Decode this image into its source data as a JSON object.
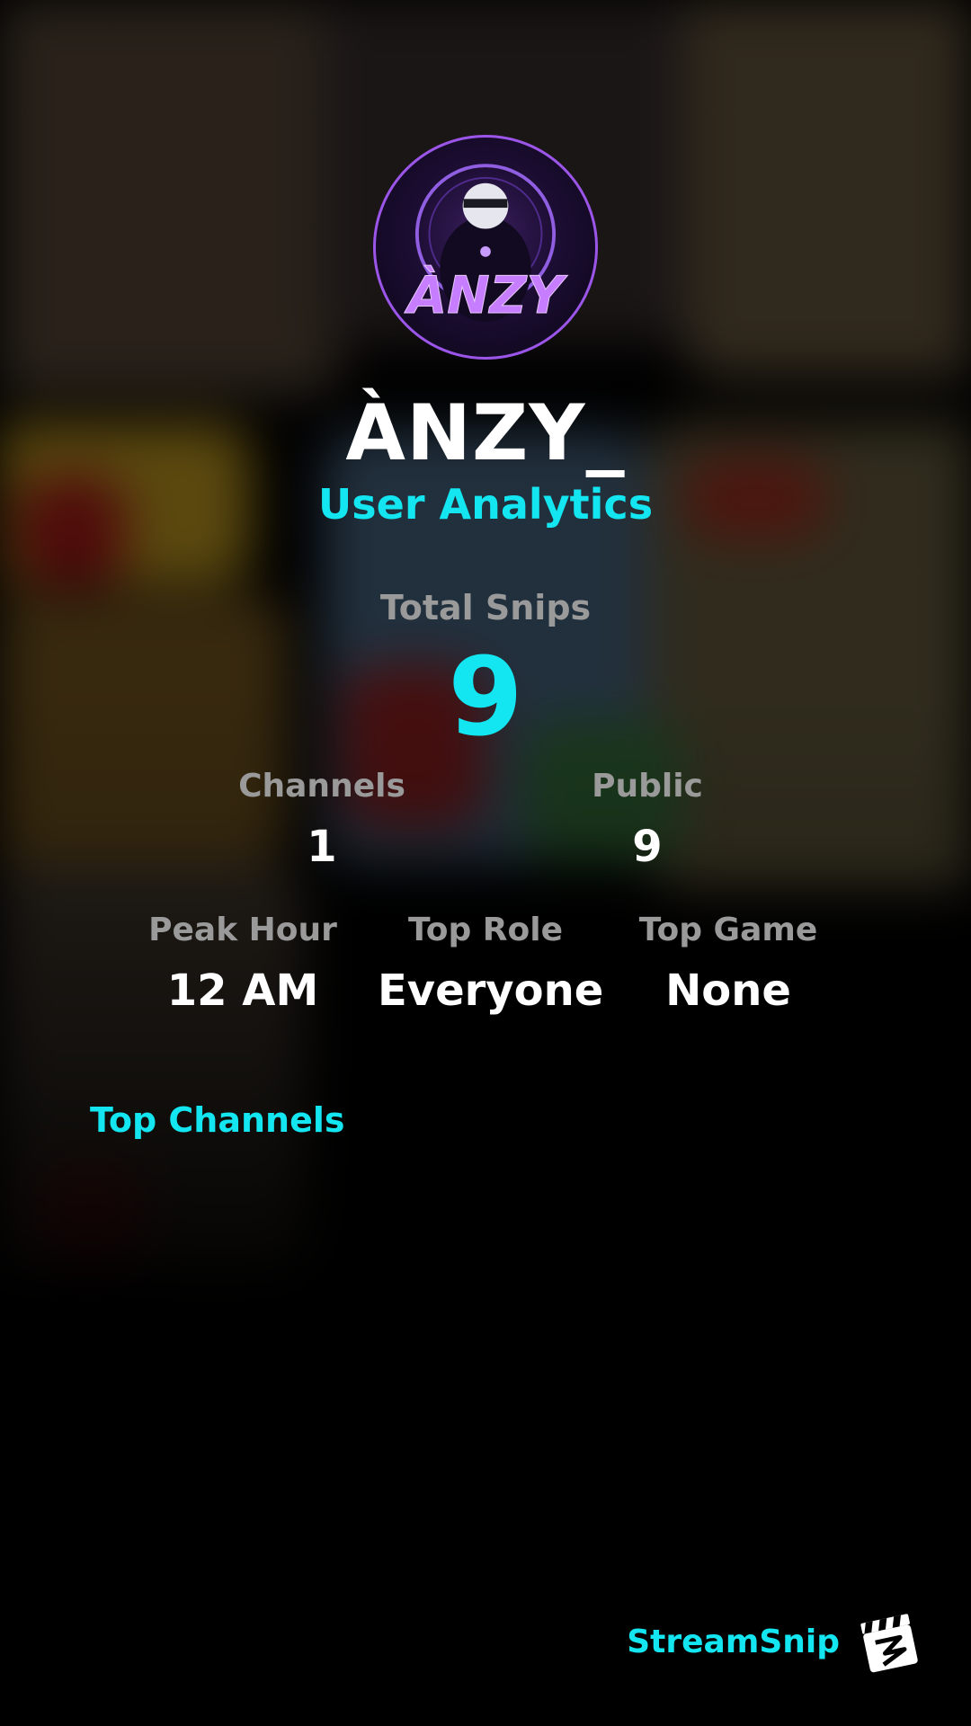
{
  "profile": {
    "username": "ÀNZY_",
    "subtitle": "User Analytics",
    "avatar_text": "ÀNZY"
  },
  "summary": {
    "total_label": "Total Snips",
    "total_value": "9"
  },
  "stats_row1": {
    "channels_label": "Channels",
    "channels_value": "1",
    "public_label": "Public",
    "public_value": "9"
  },
  "stats_row2": {
    "peak_label": "Peak Hour",
    "peak_value": "12 AM",
    "role_label": "Top Role",
    "role_value": "Everyone",
    "game_label": "Top Game",
    "game_value": "None"
  },
  "sections": {
    "top_channels_label": "Top Channels"
  },
  "branding": {
    "name": "StreamSnip",
    "logo_icon": "clapperboard-icon"
  },
  "colors": {
    "accent": "#13e6f0",
    "label_gray": "#9a9a9a",
    "background": "#000000",
    "avatar_ring": "#9b55e8"
  }
}
